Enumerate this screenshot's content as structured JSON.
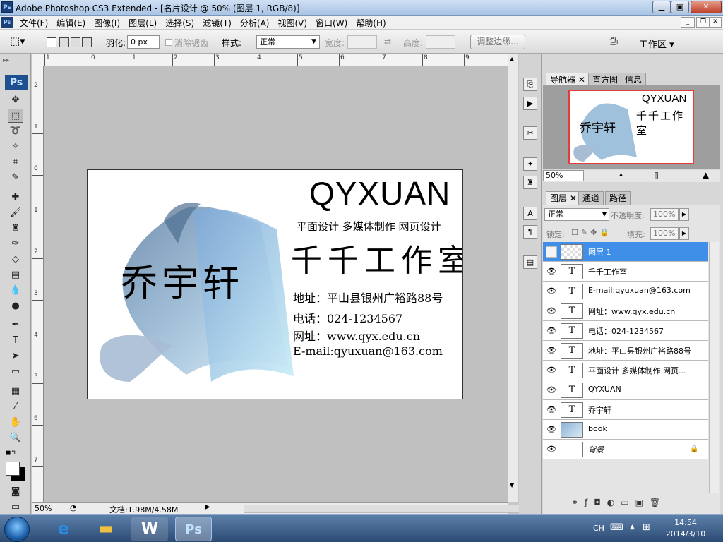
{
  "window": {
    "title": "Adobe Photoshop CS3 Extended - [名片设计 @ 50% (图层 1, RGB/8)]",
    "app_icon": "ps-icon"
  },
  "menu": [
    "文件(F)",
    "编辑(E)",
    "图像(I)",
    "图层(L)",
    "选择(S)",
    "滤镜(T)",
    "分析(A)",
    "视图(V)",
    "窗口(W)",
    "帮助(H)"
  ],
  "options": {
    "feather_label": "羽化:",
    "feather_value": "0 px",
    "antialias_label": "消除锯齿",
    "style_label": "样式:",
    "style_value": "正常",
    "width_label": "宽度:",
    "height_label": "高度:",
    "refine_button": "调整边缘...",
    "workspace": "工作区 ▾"
  },
  "toolbox": {
    "logo": "Ps"
  },
  "ruler": {
    "top_labels": [
      "1",
      "0",
      "1",
      "2",
      "3",
      "4",
      "5",
      "6",
      "7",
      "8",
      "9"
    ],
    "left_labels": [
      "2",
      "1",
      "0",
      "1",
      "2",
      "3",
      "4",
      "5",
      "6",
      "7"
    ]
  },
  "document": {
    "brand": "QYXUAN",
    "services": "平面设计 多媒体制作 网页设计",
    "studio": "千千工作室",
    "address": "地址：平山县银州广裕路88号",
    "phone": "电话：024-1234567",
    "website": "网址：www.qyx.edu.cn",
    "email": "E-mail:qyuxuan@163.com",
    "name": "乔宇轩"
  },
  "status": {
    "zoom": "50%",
    "doc_size": "文档:1.98M/4.58M"
  },
  "navigator": {
    "tabs": [
      "导航器",
      "直方图",
      "信息"
    ],
    "zoom": "50%"
  },
  "layers_panel": {
    "tabs": [
      "图层",
      "通道",
      "路径"
    ],
    "blend_mode": "正常",
    "opacity_label": "不透明度:",
    "opacity_value": "100%",
    "lock_label": "锁定:",
    "fill_label": "填充:",
    "fill_value": "100%",
    "layers": [
      {
        "name": "图层 1",
        "type": "pixel",
        "selected": true,
        "visible": false
      },
      {
        "name": "千千工作室",
        "type": "text",
        "selected": false,
        "visible": true
      },
      {
        "name": "E-mail:qyuxuan@163.com",
        "type": "text",
        "selected": false,
        "visible": true
      },
      {
        "name": "网址：www.qyx.edu.cn",
        "type": "text",
        "selected": false,
        "visible": true
      },
      {
        "name": "电话：024-1234567",
        "type": "text",
        "selected": false,
        "visible": true
      },
      {
        "name": "地址：平山县银州广裕路88号",
        "type": "text",
        "selected": false,
        "visible": true
      },
      {
        "name": "平面设计 多媒体制作 网页...",
        "type": "text",
        "selected": false,
        "visible": true
      },
      {
        "name": "QYXUAN",
        "type": "text",
        "selected": false,
        "visible": true
      },
      {
        "name": "乔宇轩",
        "type": "text",
        "selected": false,
        "visible": true
      },
      {
        "name": "book",
        "type": "smart",
        "selected": false,
        "visible": true
      },
      {
        "name": "背景",
        "type": "background",
        "selected": false,
        "visible": true,
        "locked": true
      }
    ]
  },
  "taskbar": {
    "ps_label": "Ps",
    "tray_lang": "CH",
    "time": "14:54",
    "date": "2014/3/10"
  }
}
